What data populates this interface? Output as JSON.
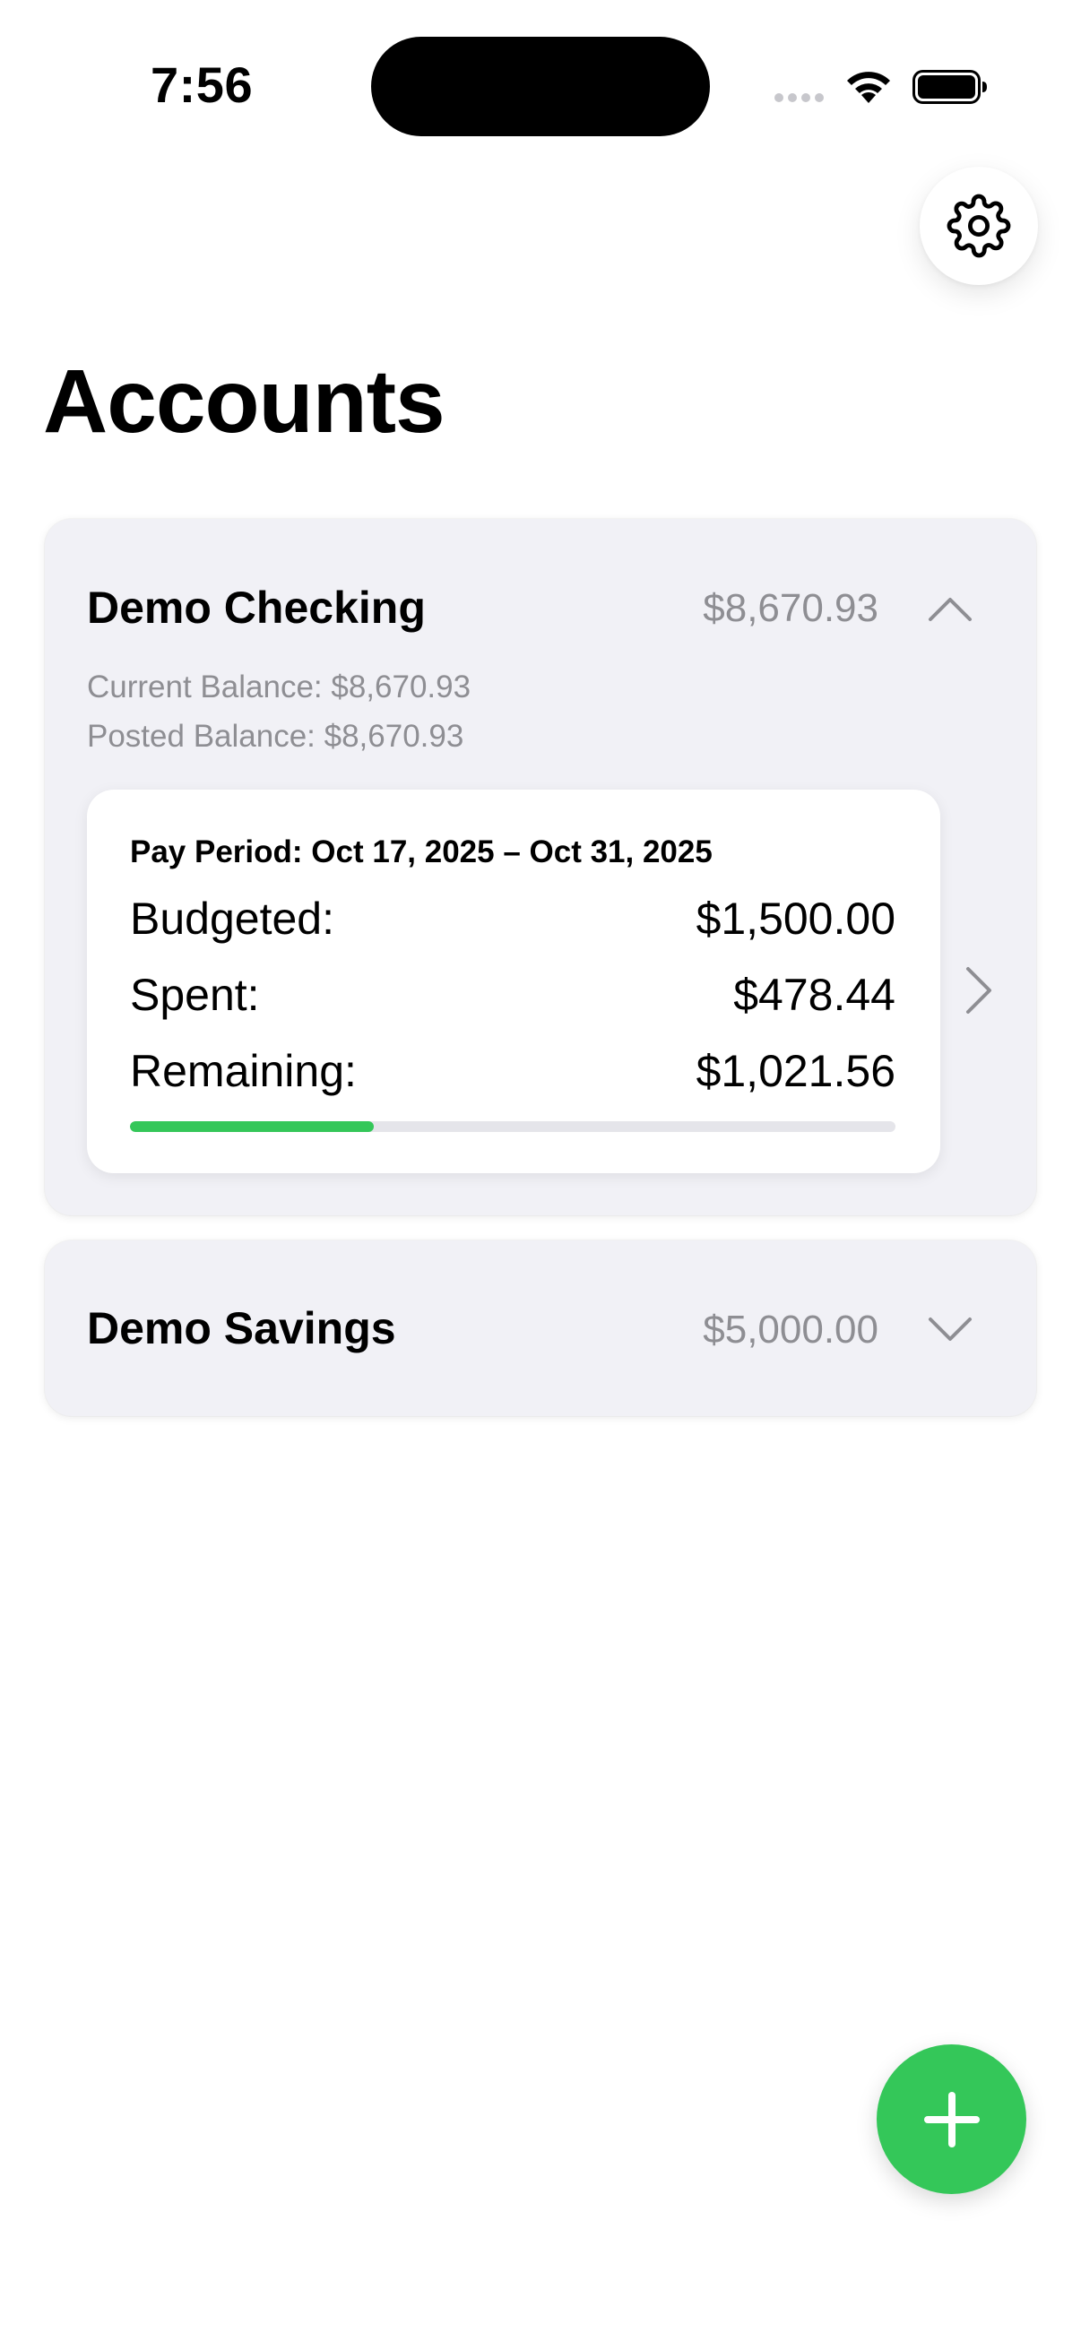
{
  "status_bar": {
    "time": "7:56"
  },
  "icons": {
    "settings": "gear-icon",
    "expand": "chevron-up-icon",
    "collapse": "chevron-down-icon",
    "detail": "chevron-right-icon",
    "add": "plus-icon"
  },
  "colors": {
    "accent": "#34c759",
    "secondary_text": "#8e8e93",
    "card_background": "#f1f1f6"
  },
  "page": {
    "title": "Accounts"
  },
  "accounts": [
    {
      "name": "Demo Checking",
      "amount": "$8,670.93",
      "expanded": true,
      "current_balance": "Current Balance: $8,670.93",
      "posted_balance": "Posted Balance: $8,670.93",
      "budget": {
        "pay_period": "Pay Period: Oct 17, 2025 – Oct 31, 2025",
        "budgeted_label": "Budgeted:",
        "budgeted_value": "$1,500.00",
        "spent_label": "Spent:",
        "spent_value": "$478.44",
        "remaining_label": "Remaining:",
        "remaining_value": "$1,021.56",
        "progress_fraction": 0.319
      }
    },
    {
      "name": "Demo Savings",
      "amount": "$5,000.00",
      "expanded": false
    }
  ]
}
